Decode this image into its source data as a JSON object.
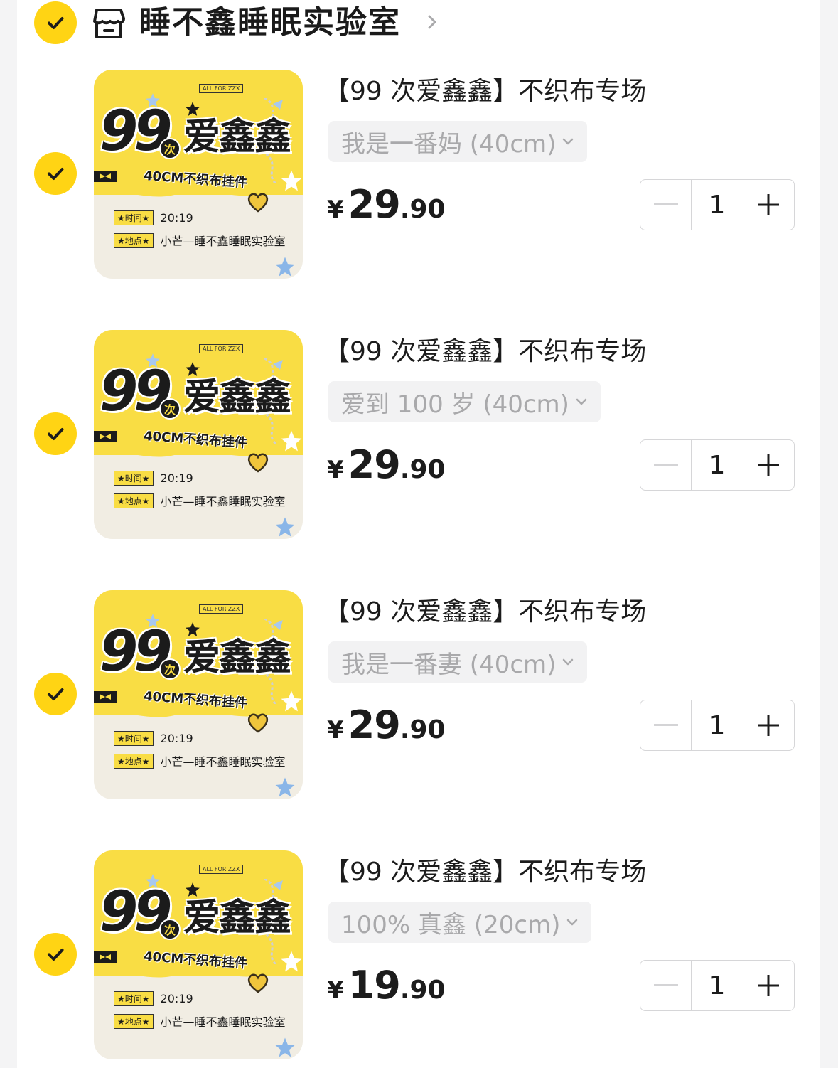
{
  "shop": {
    "name": "睡不鑫睡眠实验室",
    "icon": "shop-icon",
    "checked": true
  },
  "thumbnail": {
    "tag": "ALL FOR ZZX",
    "big_number": "99",
    "ci": "次",
    "love_text": "爱鑫鑫",
    "subtitle": "40CM不织布挂件",
    "time_label": "★时间★",
    "time_value": "20:19",
    "place_label": "★地点★",
    "place_value": "小芒—睡不鑫睡眠实验室"
  },
  "items": [
    {
      "title": "【99 次爱鑫鑫】不织布专场",
      "variant": "我是一番妈 (40cm)",
      "currency": "¥",
      "price_int": "29",
      "price_dec": ".90",
      "quantity": "1",
      "checked": true
    },
    {
      "title": "【99 次爱鑫鑫】不织布专场",
      "variant": "爱到 100 岁 (40cm)",
      "currency": "¥",
      "price_int": "29",
      "price_dec": ".90",
      "quantity": "1",
      "checked": true
    },
    {
      "title": "【99 次爱鑫鑫】不织布专场",
      "variant": "我是一番妻 (40cm)",
      "currency": "¥",
      "price_int": "29",
      "price_dec": ".90",
      "quantity": "1",
      "checked": true
    },
    {
      "title": "【99 次爱鑫鑫】不织布专场",
      "variant": "100% 真鑫 (20cm)",
      "currency": "¥",
      "price_int": "19",
      "price_dec": ".90",
      "quantity": "1",
      "checked": true
    }
  ],
  "stepper": {
    "decrement_icon": "minus-icon",
    "increment_icon": "plus-icon"
  },
  "colors": {
    "accent": "#ffd414",
    "thumb_yellow": "#f9dd44",
    "muted_text": "#a9a9ab",
    "variant_bg": "#f2f2f3"
  }
}
